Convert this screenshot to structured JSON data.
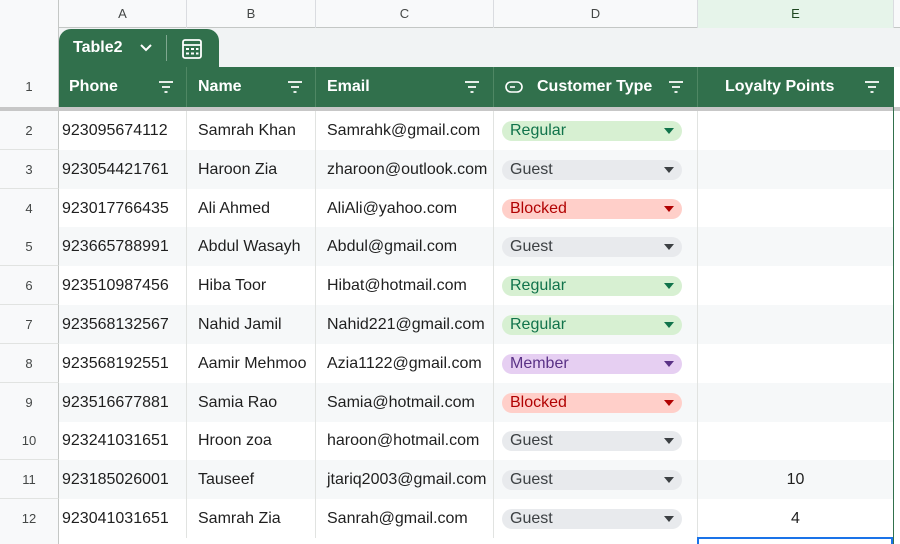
{
  "columns": [
    "A",
    "B",
    "C",
    "D",
    "E"
  ],
  "table": {
    "name": "Table2"
  },
  "header_row_number": "1",
  "headers": [
    "Phone",
    "Name",
    "Email",
    "Customer Type",
    "Loyalty Points"
  ],
  "chip_colors": {
    "Regular": {
      "bg": "#d7f0d2",
      "fg": "#11734b",
      "arrow": "#11734b"
    },
    "Guest": {
      "bg": "#e8eaed",
      "fg": "#3c4043",
      "arrow": "#3c4043"
    },
    "Blocked": {
      "bg": "#ffcfc9",
      "fg": "#b10202",
      "arrow": "#b10202"
    },
    "Member": {
      "bg": "#e6cff2",
      "fg": "#5a3286",
      "arrow": "#5a3286"
    }
  },
  "rows": [
    {
      "n": "2",
      "phone": "923095674112",
      "name": "Samrah Khan",
      "email": "Samrahk@gmail.com",
      "type": "Regular",
      "points": ""
    },
    {
      "n": "3",
      "phone": "923054421761",
      "name": "Haroon Zia",
      "email": "zharoon@outlook.com",
      "type": "Guest",
      "points": ""
    },
    {
      "n": "4",
      "phone": "923017766435",
      "name": "Ali Ahmed",
      "email": "AliAli@yahoo.com",
      "type": "Blocked",
      "points": ""
    },
    {
      "n": "5",
      "phone": "923665788991",
      "name": "Abdul Wasayh",
      "email": "Abdul@gmail.com",
      "type": "Guest",
      "points": ""
    },
    {
      "n": "6",
      "phone": "923510987456",
      "name": "Hiba Toor",
      "email": "Hibat@hotmail.com",
      "type": "Regular",
      "points": ""
    },
    {
      "n": "7",
      "phone": "923568132567",
      "name": "Nahid Jamil",
      "email": "Nahid221@gmail.com",
      "type": "Regular",
      "points": ""
    },
    {
      "n": "8",
      "phone": "923568192551",
      "name": "Aamir Mehmoo",
      "email": "Azia1122@gmail.com",
      "type": "Member",
      "points": ""
    },
    {
      "n": "9",
      "phone": "923516677881",
      "name": "Samia Rao",
      "email": "Samia@hotmail.com",
      "type": "Blocked",
      "points": ""
    },
    {
      "n": "10",
      "phone": "923241031651",
      "name": "Hroon zoa",
      "email": "haroon@hotmail.com",
      "type": "Guest",
      "points": ""
    },
    {
      "n": "11",
      "phone": "923185026001",
      "name": "Tauseef",
      "email": "jtariq2003@gmail.com",
      "type": "Guest",
      "points": "10"
    },
    {
      "n": "12",
      "phone": "923041031651",
      "name": "Samrah Zia",
      "email": "Sanrah@gmail.com",
      "type": "Guest",
      "points": "4"
    }
  ]
}
